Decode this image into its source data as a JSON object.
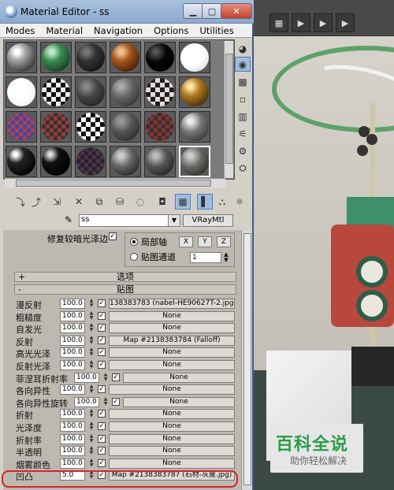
{
  "window": {
    "title": "Material Editor - ss"
  },
  "menu": [
    "Modes",
    "Material",
    "Navigation",
    "Options",
    "Utilities"
  ],
  "material": {
    "name": "ss",
    "type": "VRayMtl"
  },
  "top_panel": {
    "repair_label": "修复较暗光泽边",
    "repair_check": "✓",
    "local_axis": "局部轴",
    "map_channel": "贴图通道",
    "axes": [
      "X",
      "Y",
      "Z"
    ],
    "channel_value": "1"
  },
  "rollouts": {
    "options": {
      "sign": "+",
      "label": "选项"
    },
    "maps": {
      "sign": "-",
      "label": "贴图"
    }
  },
  "maps": [
    {
      "label": "漫反射",
      "amount": "100.0",
      "check": "✓",
      "map": "138383783 (nabel-HE90627T-2.jpg)"
    },
    {
      "label": "粗糙度",
      "amount": "100.0",
      "check": "✓",
      "map": "None"
    },
    {
      "label": "自发光",
      "amount": "100.0",
      "check": "✓",
      "map": "None"
    },
    {
      "label": "反射",
      "amount": "100.0",
      "check": "✓",
      "map": "Map #2138383784 (Falloff)"
    },
    {
      "label": "高光光泽",
      "amount": "100.0",
      "check": "✓",
      "map": "None"
    },
    {
      "label": "反射光泽",
      "amount": "100.0",
      "check": "✓",
      "map": "None"
    },
    {
      "label": "菲涅耳折射率",
      "amount": "100.0",
      "check": "✓",
      "map": "None"
    },
    {
      "label": "各向异性",
      "amount": "100.0",
      "check": "✓",
      "map": "None"
    },
    {
      "label": "各向异性旋转",
      "amount": "100.0",
      "check": "✓",
      "map": "None"
    },
    {
      "label": "折射",
      "amount": "100.0",
      "check": "✓",
      "map": "None"
    },
    {
      "label": "光泽度",
      "amount": "100.0",
      "check": "✓",
      "map": "None"
    },
    {
      "label": "折射率",
      "amount": "100.0",
      "check": "✓",
      "map": "None"
    },
    {
      "label": "半透明",
      "amount": "100.0",
      "check": "✓",
      "map": "None"
    },
    {
      "label": "烟雾颜色",
      "amount": "100.0",
      "check": "✓",
      "map": "None"
    },
    {
      "label": "凹凸",
      "amount": "5.0",
      "check": "✓",
      "map": "Map #2138383787 (石材-灰度.jpg)"
    }
  ],
  "logo": {
    "title": "百科全说",
    "subtitle": "助你轻松解决"
  },
  "colors": {
    "titlebar": "#8ea9cd",
    "highlight": "#d8242a",
    "logo_green": "#2a9d4a"
  }
}
